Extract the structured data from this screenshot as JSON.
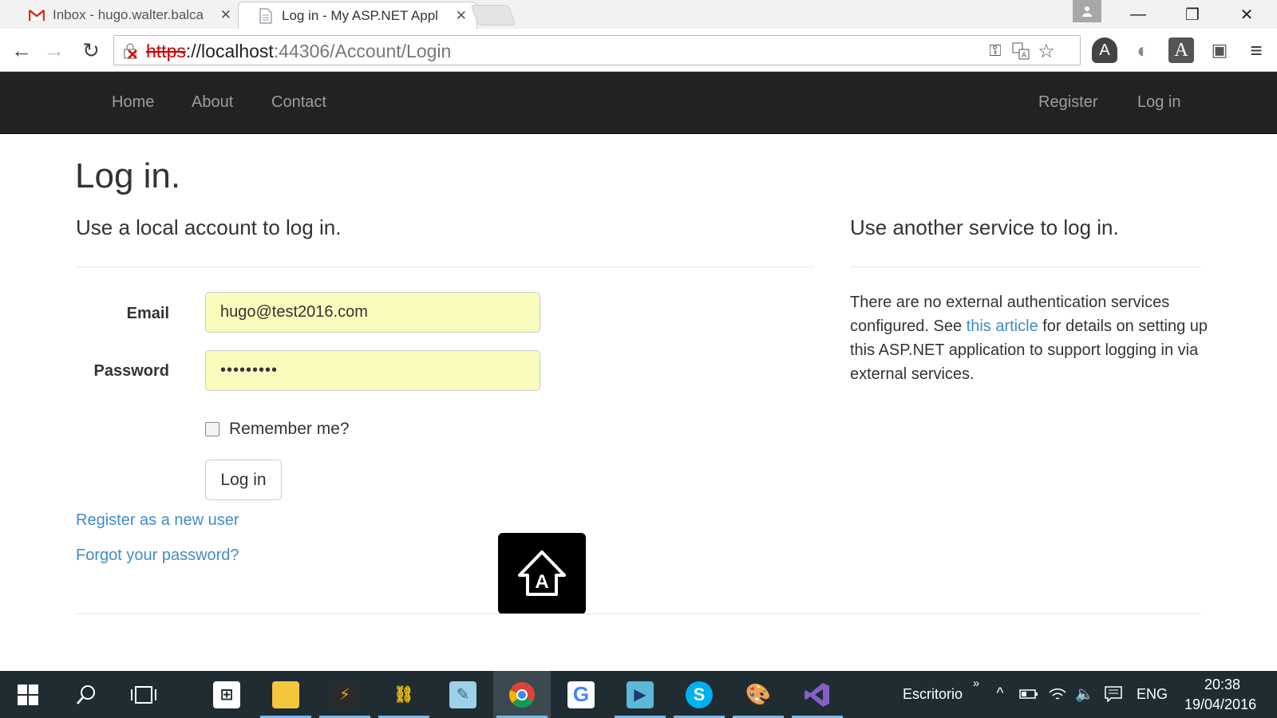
{
  "browser": {
    "tabs": [
      {
        "title": "Inbox - hugo.walter.balca",
        "icon": "gmail-icon"
      },
      {
        "title": "Log in - My ASP.NET Appl",
        "icon": "page-icon"
      }
    ],
    "url": {
      "scheme": "https",
      "host": "://localhost",
      "path": ":44306/Account/Login"
    }
  },
  "navbar": {
    "left": [
      "Home",
      "About",
      "Contact"
    ],
    "right": [
      "Register",
      "Log in"
    ]
  },
  "page": {
    "title": "Log in.",
    "local_heading": "Use a local account to log in.",
    "external_heading": "Use another service to log in.",
    "email_label": "Email",
    "email_value": "hugo@test2016.com",
    "password_label": "Password",
    "password_value": "•••••••••",
    "remember_label": "Remember me?",
    "login_button": "Log in",
    "register_link": "Register as a new user",
    "forgot_link": "Forgot your password?",
    "external_text_1": "There are no external authentication services configured. See ",
    "external_link": "this article",
    "external_text_2": " for details on setting up this ASP.NET application to support logging in via external services."
  },
  "taskbar": {
    "desktop_label": "Escritorio",
    "language": "ENG",
    "time": "20:38",
    "date": "19/04/2016"
  },
  "colors": {
    "navbar": "#222222",
    "link": "#428bca",
    "autofill": "#fafcbd",
    "taskbar": "#1f2d33"
  }
}
